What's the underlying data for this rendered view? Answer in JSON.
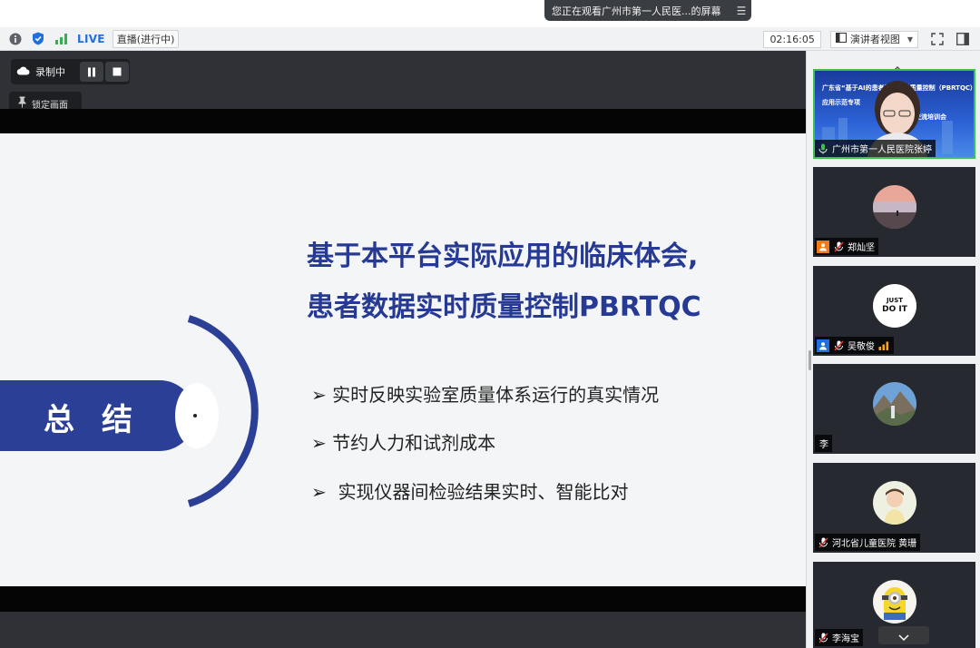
{
  "banner": {
    "text": "您正在观看广州市第一人民医...的屏幕"
  },
  "toolbar": {
    "live": "LIVE",
    "live_status": "直播(进行中)",
    "timer": "02:16:05",
    "view_mode": "演讲者视图"
  },
  "recording": {
    "label": "录制中",
    "lock_label": "锁定画面"
  },
  "slide": {
    "title_line1": "基于本平台实际应用的临床体会,",
    "title_line2": "患者数据实时质量控制PBRTQC",
    "summary": "总结",
    "bullets": [
      "实时反映实验室质量体系运行的真实情况",
      "节约人力和试剂成本",
      "实现仪器间检验结果实时、智能比对"
    ]
  },
  "participants": [
    {
      "name": "广州市第一人民医院张婷",
      "video": [
        "广东省“基于AI的患者数据实时质量控制（PBRTQC）",
        "应用示范专项",
        "交流培训会"
      ]
    },
    {
      "name": "郑灿坚"
    },
    {
      "name": "吴敬俊",
      "avatar_text": [
        "JUST",
        "DO IT"
      ]
    },
    {
      "name": "李"
    },
    {
      "name": "河北省儿童医院 黄珊"
    },
    {
      "name": "李海宝"
    }
  ],
  "colors": {
    "accent": "#263a94",
    "live": "#1f6fe0",
    "active_border": "#3fbf4e"
  }
}
